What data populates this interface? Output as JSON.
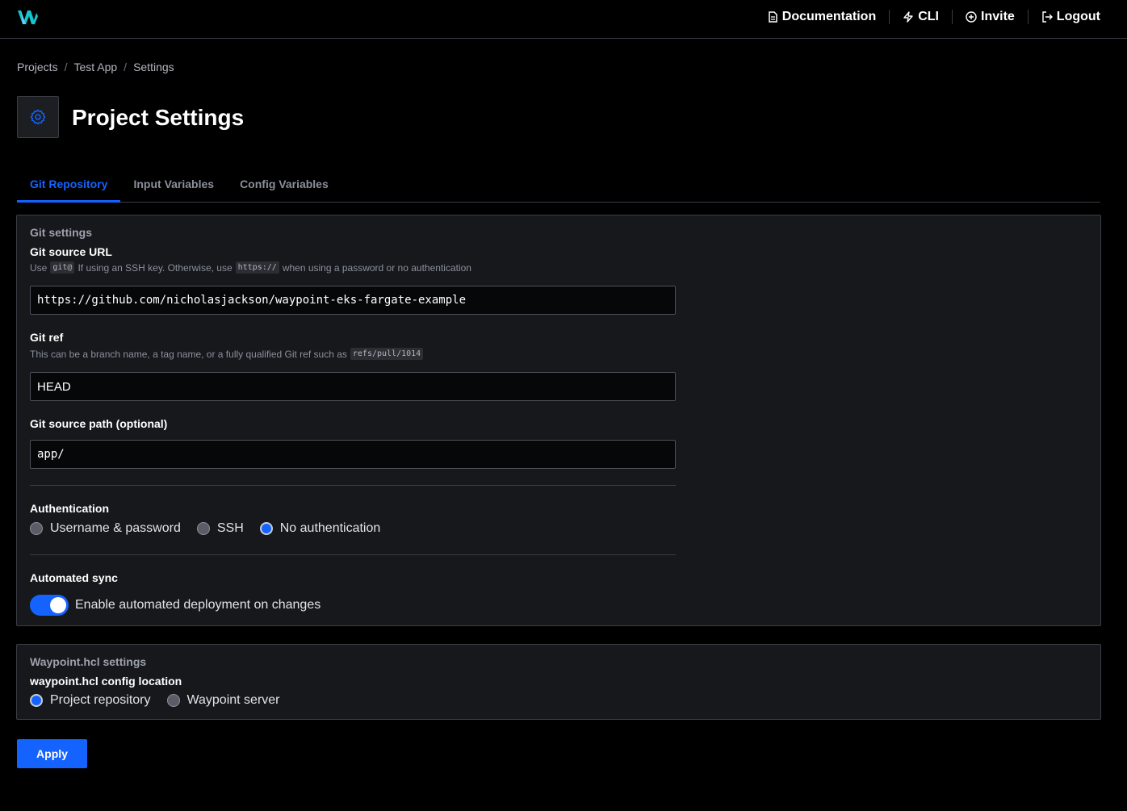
{
  "colors": {
    "accent": "#1563ff",
    "background": "#000000",
    "panel": "#16181c"
  },
  "nav": {
    "documentation": "Documentation",
    "cli": "CLI",
    "invite": "Invite",
    "logout": "Logout"
  },
  "breadcrumb": {
    "projects": "Projects",
    "app": "Test App",
    "settings": "Settings",
    "separator": "/"
  },
  "page": {
    "title": "Project Settings"
  },
  "tabs": [
    {
      "label": "Git Repository",
      "active": true
    },
    {
      "label": "Input Variables",
      "active": false
    },
    {
      "label": "Config Variables",
      "active": false
    }
  ],
  "git": {
    "legend": "Git settings",
    "source_url": {
      "label": "Git source URL",
      "help_prefix": "Use",
      "help_code1": "git@",
      "help_middle": "If using an SSH key. Otherwise, use",
      "help_code2": "https://",
      "help_suffix": "when using a password or no authentication",
      "value": "https://github.com/nicholasjackson/waypoint-eks-fargate-example"
    },
    "ref": {
      "label": "Git ref",
      "help": "This can be a branch name, a tag name, or a fully qualified Git ref such as",
      "help_code": "refs/pull/1014",
      "value": "HEAD"
    },
    "path": {
      "label": "Git source path (optional)",
      "value": "app/"
    },
    "auth": {
      "label": "Authentication",
      "options": [
        {
          "label": "Username & password",
          "selected": false
        },
        {
          "label": "SSH",
          "selected": false
        },
        {
          "label": "No authentication",
          "selected": true
        }
      ]
    },
    "sync": {
      "label": "Automated sync",
      "toggle_label": "Enable automated deployment on changes",
      "enabled": true
    }
  },
  "waypoint": {
    "legend": "Waypoint.hcl settings",
    "location_label": "waypoint.hcl config location",
    "options": [
      {
        "label": "Project repository",
        "selected": true
      },
      {
        "label": "Waypoint server",
        "selected": false
      }
    ]
  },
  "apply_label": "Apply"
}
